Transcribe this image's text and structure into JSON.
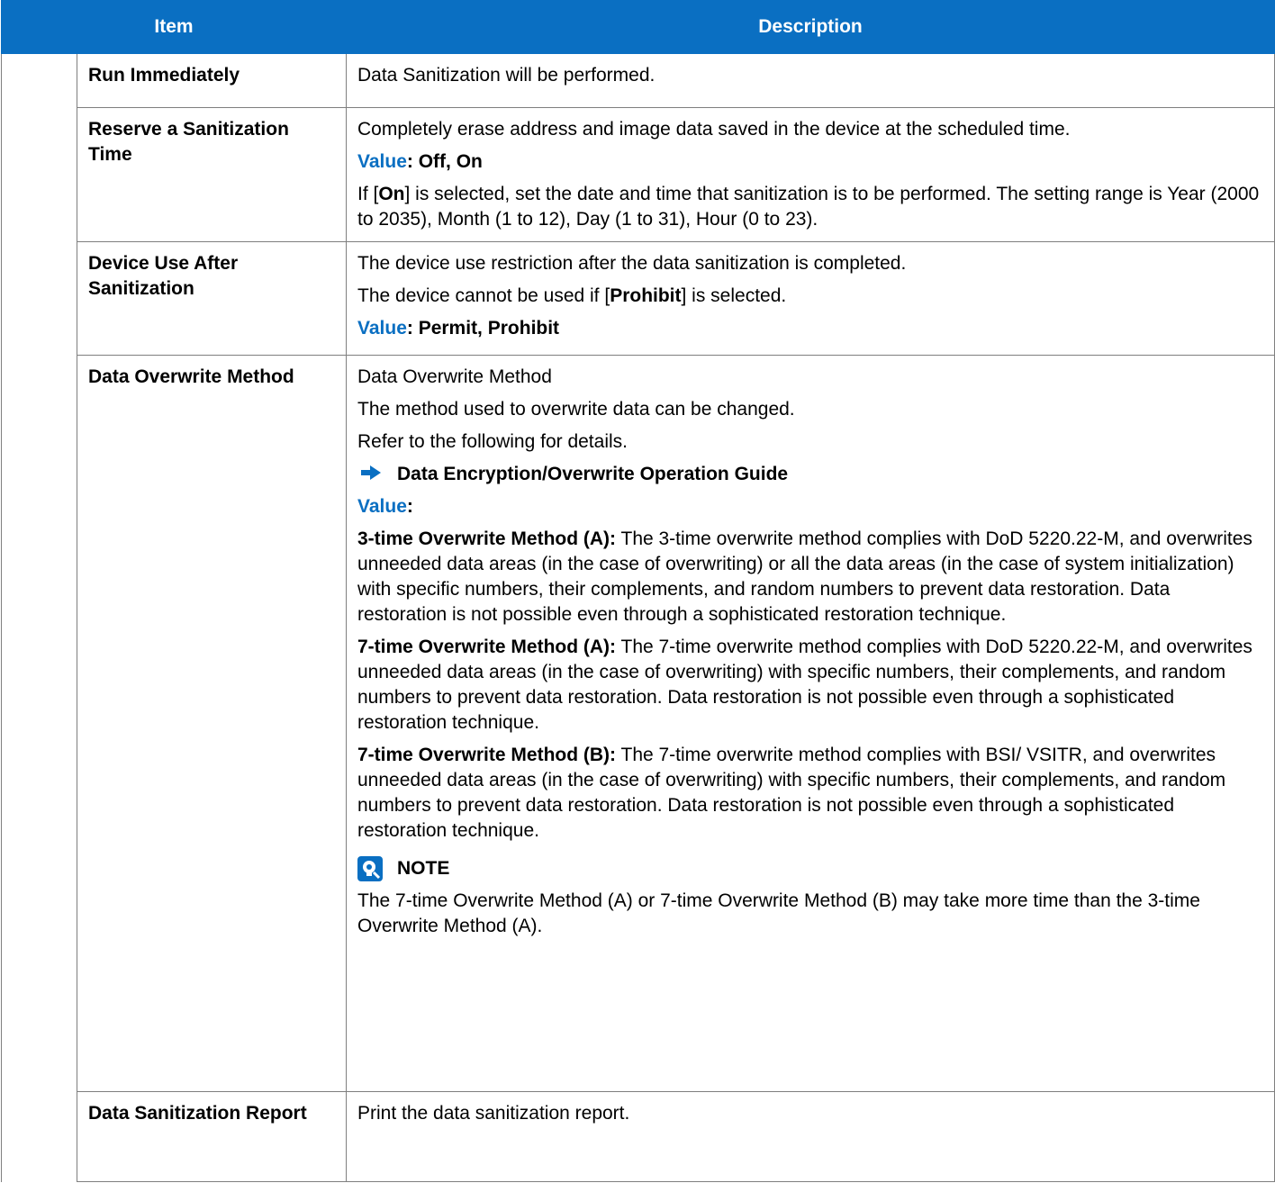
{
  "header": {
    "item": "Item",
    "description": "Description"
  },
  "rows": {
    "run": {
      "item": "Run Immediately",
      "desc": "Data Sanitization will be performed."
    },
    "reserve": {
      "item": "Reserve a Sanitization Time",
      "desc1": "Completely erase address and image data saved in the device at the scheduled time.",
      "value_label": "Value",
      "value_text": ": Off, On",
      "p3_pre": "If [",
      "p3_bold": "On",
      "p3_post": "] is selected, set the date and time that sanitization is to be performed. The setting range is Year (2000 to 2035), Month (1 to 12), Day (1 to 31), Hour (0 to 23)."
    },
    "device": {
      "item": "Device Use After Sanitization",
      "desc1": "The device use restriction after the data sanitization is completed.",
      "p2_pre": "The device cannot be used if [",
      "p2_bold": "Prohibit",
      "p2_post": "] is selected.",
      "value_label": "Value",
      "value_text": ": Permit, Prohibit"
    },
    "overwrite": {
      "item": "Data Overwrite Method",
      "desc1": "Data Overwrite Method",
      "desc2": "The method used to overwrite data can be changed.",
      "desc3": "Refer to the following for details.",
      "ref": "Data Encryption/Overwrite Operation Guide",
      "value_label": "Value",
      "value_colon": ":",
      "m1_title": "3-time Overwrite Method (A):",
      "m1_text": " The 3-time overwrite method complies with DoD 5220.22-M, and overwrites unneeded data areas (in the case of overwriting) or all the data areas (in the case of system initialization) with specific numbers, their complements, and random numbers to prevent data restoration. Data restoration is not possible even through a sophisticated restoration technique.",
      "m2_title": "7-time Overwrite Method (A):",
      "m2_text": " The 7-time overwrite method complies with DoD 5220.22-M, and overwrites unneeded data areas (in the case of overwriting) with specific numbers, their complements, and random numbers to prevent data restoration. Data restoration is not possible even through a sophisticated restoration technique.",
      "m3_title": "7-time Overwrite Method (B):",
      "m3_text": " The 7-time overwrite method complies with BSI/ VSITR, and overwrites unneeded data areas (in the case of overwriting) with specific numbers, their complements, and random numbers to prevent data restoration. Data restoration is not possible even through a sophisticated restoration technique.",
      "note_title": "NOTE",
      "note_text": "The 7-time Overwrite Method (A) or 7-time Overwrite Method (B) may take more time than the 3-time Overwrite Method (A)."
    },
    "report": {
      "item": "Data Sanitization Report",
      "desc": "Print the data sanitization report."
    }
  },
  "colors": {
    "accent": "#0a6fc2",
    "border": "#7f7f7f"
  },
  "icons": {
    "reference": "arrow-right-icon",
    "note": "note-icon"
  }
}
